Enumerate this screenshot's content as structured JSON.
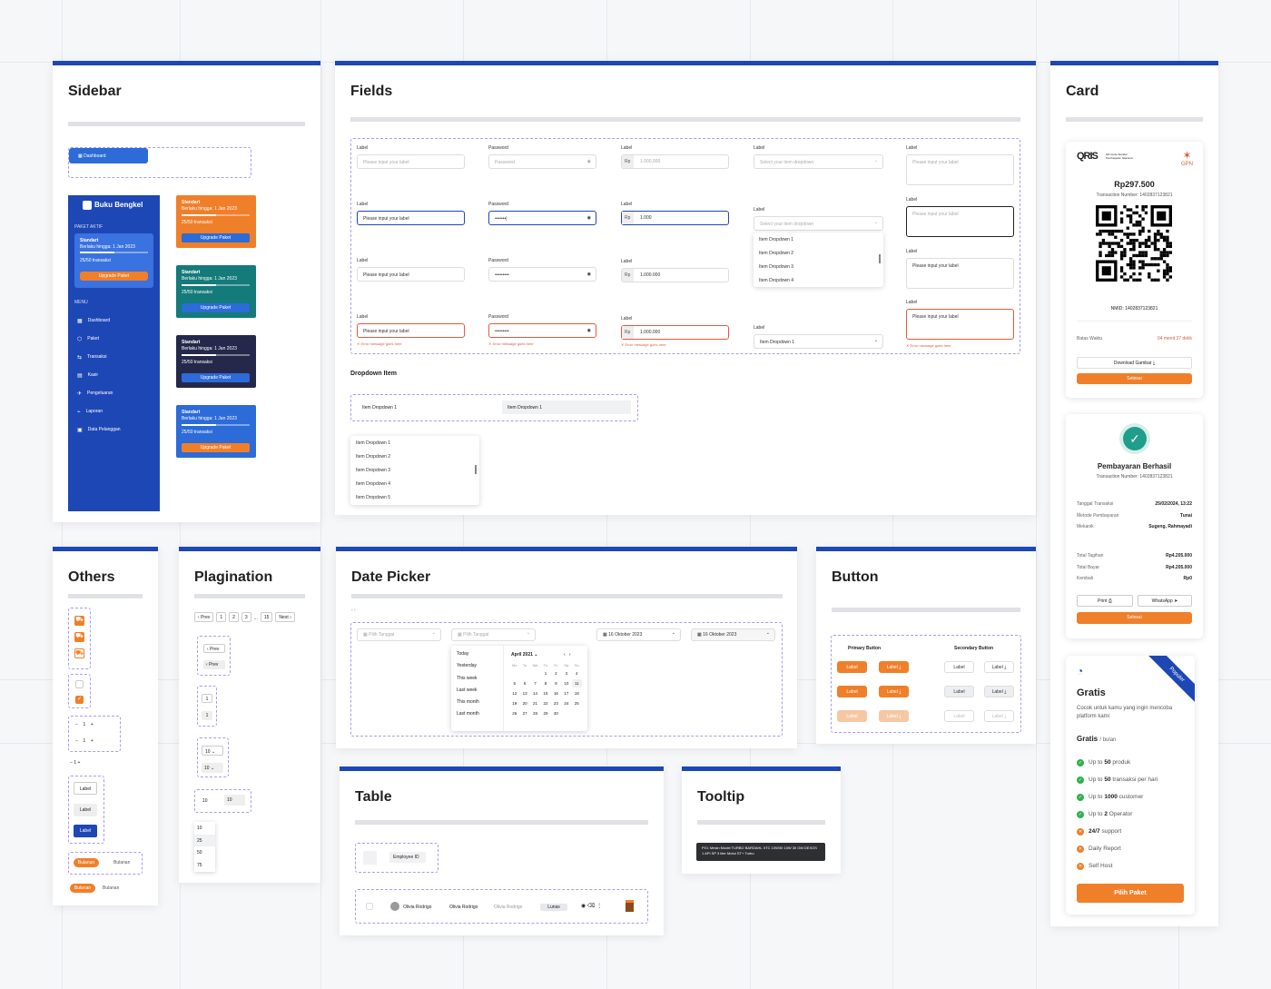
{
  "panels": {
    "sidebar": "Sidebar",
    "fields": "Fields",
    "card": "Card",
    "others": "Others",
    "pagination": "Plagination",
    "datepicker": "Date Picker",
    "button": "Button",
    "table": "Table",
    "tooltip": "Tooltip"
  },
  "sidebar": {
    "dashboard_chip": "Dashboard",
    "brand": "Buku Bengkel",
    "paket_aktif": "PAKET AKTIF",
    "menu_label": "MENU",
    "plan": {
      "name": "Standart",
      "expiry": "Berlaku hingga: 1 Jan 2023",
      "usage": "25/50 transaksi",
      "upgrade": "Upgrade Paket"
    },
    "menu": [
      {
        "icon": "grid-icon",
        "label": "Dashboard"
      },
      {
        "icon": "box-icon",
        "label": "Paket"
      },
      {
        "icon": "transfer-icon",
        "label": "Transaksi"
      },
      {
        "icon": "cashier-icon",
        "label": "Kasir"
      },
      {
        "icon": "expense-icon",
        "label": "Pengeluaran"
      },
      {
        "icon": "report-icon",
        "label": "Laporan"
      },
      {
        "icon": "customer-icon",
        "label": "Data Pelanggan"
      }
    ],
    "plan_cards": [
      {
        "color": "#f07f2a"
      },
      {
        "color": "#147a7a"
      },
      {
        "color": "#25284a"
      },
      {
        "color": "#2c6bd8"
      }
    ]
  },
  "fields": {
    "label": "Label",
    "password": "Password",
    "placeholder": "Please input your label",
    "password_placeholder": "Password",
    "value_label": "Please input your label",
    "rp": "Rp",
    "amount_placeholder": "1.000.000",
    "amount_typing": "1.000",
    "amount": "1.000.000",
    "dropdown_placeholder": "Select your item dropdown",
    "dropdown_selected": "Item Dropdown 1",
    "error": "Error message goes here",
    "dropdown_items": [
      "Item Dropdown 1",
      "Item Dropdown 2",
      "Item Dropdown 3",
      "Item Dropdown 4"
    ],
    "dropdown_section": "Dropdown Item",
    "dd_item": "Item Dropdown 1",
    "dd_list": [
      "Item Dropdown 1",
      "Item Dropdown 2",
      "Item Dropdown 3",
      "Item Dropdown 4",
      "Item Dropdown 5"
    ]
  },
  "card": {
    "qris": "QRIS",
    "qris_sub": "QR Code Standar Pembayaran Nasional",
    "gpn": "GPN",
    "amount": "Rp297.500",
    "trx": "Transaction Number: 1402837123821",
    "nmid": "NMID: 1402837123821",
    "batas": "Batas Waktu",
    "timer": "04 menit 37 detik",
    "download": "Download Gambar",
    "selesai": "Selesai",
    "success_title": "Pembayaran Berhasil",
    "success_trx": "Transaction Number: 1402837123821",
    "details": [
      [
        "Tanggal Transaksi",
        "25/02/2024, 13:22"
      ],
      [
        "Metode Pembayaran",
        "Tunai"
      ],
      [
        "Mekanik",
        "Sugeng, Rahmayadi"
      ]
    ],
    "totals": [
      [
        "Total Tagihan",
        "Rp4.205.000"
      ],
      [
        "Total Bayar",
        "Rp4.205.000"
      ],
      [
        "Kembali",
        "Rp0"
      ]
    ],
    "print": "Print",
    "whatsapp": "WhatsApp",
    "selesai2": "Selesai",
    "plan_name": "Gratis",
    "plan_desc": "Cocok untuk kamu yang ingin mencoba platform kami",
    "plan_price": "Gratis",
    "plan_period": "/ bulan",
    "ribbon": "Populer",
    "features": [
      {
        "pre": "Up to ",
        "b": "50",
        "post": " produk",
        "ok": true
      },
      {
        "pre": "Up to ",
        "b": "50",
        "post": " transaksi per hari",
        "ok": true
      },
      {
        "pre": "Up to ",
        "b": "1000",
        "post": " customer",
        "ok": true
      },
      {
        "pre": "Up to ",
        "b": "2",
        "post": " Operator",
        "ok": true
      },
      {
        "pre": "",
        "b": "24/7",
        "post": " support",
        "ok": false
      },
      {
        "pre": "Daily Report",
        "b": "",
        "post": "",
        "ok": false
      },
      {
        "pre": "Self Host",
        "b": "",
        "post": "",
        "ok": false
      }
    ],
    "cta": "Pilih Paket"
  },
  "others": {
    "stepper": "1",
    "chip_label": "Label",
    "bulanan": "Bulanan"
  },
  "pagination": {
    "prev": "Prev",
    "next": "Next",
    "pages": [
      "1",
      "2",
      "3",
      "...",
      "15"
    ],
    "page1": "1",
    "per_page": "10",
    "options": [
      "10",
      "25",
      "50",
      "75"
    ]
  },
  "datepicker": {
    "placeholder": "Pilih Tanggal",
    "date": "16 Oktober 2023",
    "month": "April 2021",
    "presets": [
      "Today",
      "Yesterday",
      "This week",
      "Last week",
      "This month",
      "Last month"
    ],
    "weekdays": [
      "Mo",
      "Tu",
      "We",
      "Th",
      "Fr",
      "Sa",
      "Su"
    ],
    "days": [
      "",
      "",
      "",
      "1",
      "2",
      "3",
      "4",
      "5",
      "6",
      "7",
      "8",
      "9",
      "10",
      "11",
      "12",
      "13",
      "14",
      "15",
      "16",
      "17",
      "18",
      "19",
      "20",
      "21",
      "22",
      "23",
      "24",
      "25",
      "26",
      "27",
      "28",
      "29",
      "30",
      "",
      ""
    ]
  },
  "buttons": {
    "primary": "Primary Button",
    "secondary": "Secondary Button",
    "label": "Label"
  },
  "table": {
    "employee_id": "Employee ID",
    "name": "Olivia Rodrigo",
    "name2": "Olivia Rodrigo",
    "name3": "Olivia Rodrigo",
    "status": "Lunas"
  },
  "tooltip": {
    "text": "PGl: Mesin Model TURBO BARDAHL XTC 10W30 10W 30 GM DEXOS 1 API SP 3 liter Motul ST+ Turbo"
  }
}
